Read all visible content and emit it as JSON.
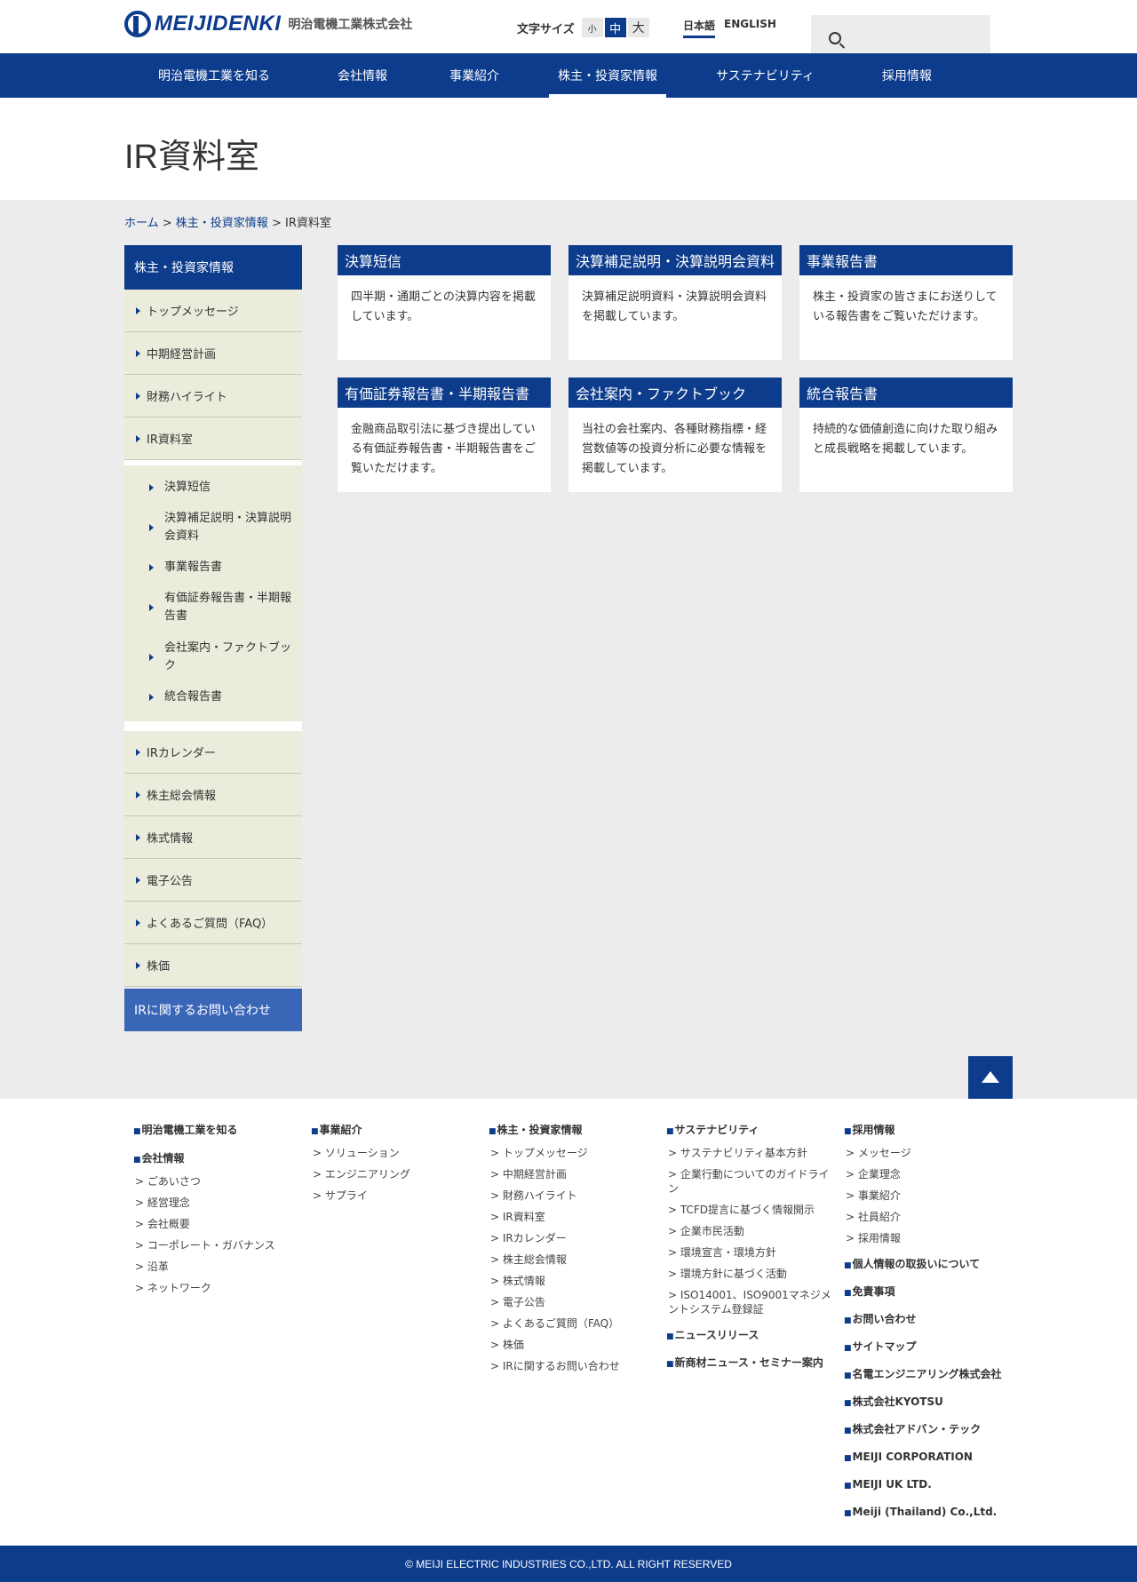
{
  "header": {
    "logo_text": "MEIJIDENKI",
    "logo_jp": "明治電機工業株式会社",
    "fontsize_label": "文字サイズ",
    "fontsize_small": "小",
    "fontsize_mid": "中",
    "fontsize_large": "大",
    "lang_jp": "日本語",
    "lang_en": "ENGLISH"
  },
  "gnav": [
    "明治電機工業を知る",
    "会社情報",
    "事業紹介",
    "株主・投資家情報",
    "サステナビリティ",
    "採用情報"
  ],
  "page_title": "IR資料室",
  "breadcrumb": {
    "home": "ホーム",
    "sep": " > ",
    "parent": "株主・投資家情報",
    "current": "IR資料室"
  },
  "sidebar": {
    "header": "株主・投資家情報",
    "items_top": [
      "トップメッセージ",
      "中期経営計画",
      "財務ハイライト",
      "IR資料室"
    ],
    "sub_items": [
      "決算短信",
      "決算補足説明・決算説明会資料",
      "事業報告書",
      "有価証券報告書・半期報告書",
      "会社案内・ファクトブック",
      "統合報告書"
    ],
    "items_bottom": [
      "IRカレンダー",
      "株主総会情報",
      "株式情報",
      "電子公告",
      "よくあるご質問（FAQ）",
      "株価"
    ],
    "contact": "IRに関するお問い合わせ"
  },
  "cards": [
    {
      "title": "決算短信",
      "body": "四半期・通期ごとの決算内容を掲載しています。"
    },
    {
      "title": "決算補足説明・決算説明会資料",
      "body": "決算補足説明資料・決算説明会資料を掲載しています。"
    },
    {
      "title": "事業報告書",
      "body": "株主・投資家の皆さまにお送りしている報告書をご覧いただけます。"
    },
    {
      "title": "有価証券報告書・半期報告書",
      "body": "金融商品取引法に基づき提出している有価証券報告書・半期報告書をご覧いただけます。"
    },
    {
      "title": "会社案内・ファクトブック",
      "body": "当社の会社案内、各種財務指標・経営数値等の投資分析に必要な情報を掲載しています。"
    },
    {
      "title": "統合報告書",
      "body": "持続的な価値創造に向けた取り組みと成長戦略を掲載しています。"
    }
  ],
  "footer": {
    "col1": {
      "heads": [
        "明治電機工業を知る",
        "会社情報"
      ],
      "links": [
        "ごあいさつ",
        "経営理念",
        "会社概要",
        "コーポレート・ガバナンス",
        "沿革",
        "ネットワーク"
      ]
    },
    "col2": {
      "head": "事業紹介",
      "links": [
        "ソリューション",
        "エンジニアリング",
        "サプライ"
      ]
    },
    "col3": {
      "head": "株主・投資家情報",
      "links": [
        "トップメッセージ",
        "中期経営計画",
        "財務ハイライト",
        "IR資料室",
        "IRカレンダー",
        "株主総会情報",
        "株式情報",
        "電子公告",
        "よくあるご質問（FAQ）",
        "株価",
        "IRに関するお問い合わせ"
      ]
    },
    "col4": {
      "head": "サステナビリティ",
      "links": [
        "サステナビリティ基本方針",
        "企業行動についてのガイドライン",
        "TCFD提言に基づく情報開示",
        "企業市民活動",
        "環境宣言・環境方針",
        "環境方針に基づく活動",
        "ISO14001、ISO9001マネジメントシステム登録証"
      ],
      "heads_after": [
        "ニュースリリース",
        "新商材ニュース・セミナー案内"
      ]
    },
    "col5": {
      "head": "採用情報",
      "links": [
        "メッセージ",
        "企業理念",
        "事業紹介",
        "社員紹介",
        "採用情報"
      ],
      "heads_after": [
        "個人情報の取扱いについて",
        "免責事項",
        "お問い合わせ",
        "サイトマップ",
        "名電エンジニアリング株式会社",
        "株式会社KYOTSU",
        "株式会社アドバン・テック",
        "MEIJI CORPORATION",
        "MEIJI UK LTD.",
        "Meiji (Thailand) Co.,Ltd."
      ]
    },
    "copyright": "© MEIJI ELECTRIC INDUSTRIES CO.,LTD. ALL RIGHT RESERVED"
  }
}
